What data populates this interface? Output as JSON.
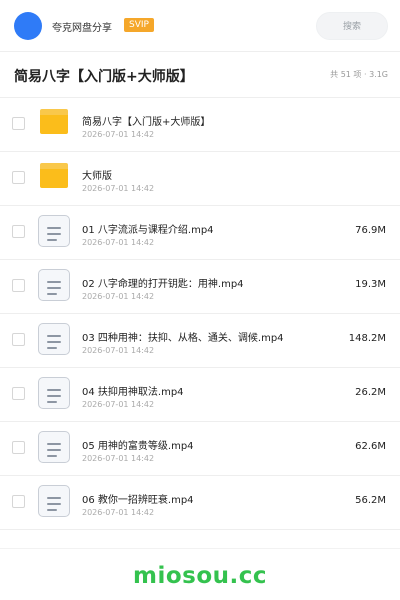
{
  "header": {
    "share_name": "夸克网盘分享",
    "badge": "SVIP",
    "search_placeholder": "搜索"
  },
  "titlebar": {
    "title": "简易八字【入门版+大师版】",
    "meta": "共 51 项 · 3.1G"
  },
  "items": [
    {
      "type": "folder",
      "name": "简易八字【入门版+大师版】",
      "date": "2026-07-01 14:42",
      "size": ""
    },
    {
      "type": "folder",
      "name": "大师版",
      "date": "2026-07-01 14:42",
      "size": ""
    },
    {
      "type": "file",
      "name": "01 八字流派与课程介绍.mp4",
      "date": "2026-07-01 14:42",
      "size": "76.9M"
    },
    {
      "type": "file",
      "name": "02 八字命理的打开钥匙：用神.mp4",
      "date": "2026-07-01 14:42",
      "size": "19.3M"
    },
    {
      "type": "file",
      "name": "03 四种用神：扶抑、从格、通关、调候.mp4",
      "date": "2026-07-01 14:42",
      "size": "148.2M"
    },
    {
      "type": "file",
      "name": "04 扶抑用神取法.mp4",
      "date": "2026-07-01 14:42",
      "size": "26.2M"
    },
    {
      "type": "file",
      "name": "05 用神的富贵等级.mp4",
      "date": "2026-07-01 14:42",
      "size": "62.6M"
    },
    {
      "type": "file",
      "name": "06 教你一招辨旺衰.mp4",
      "date": "2026-07-01 14:42",
      "size": "56.2M"
    }
  ],
  "footer": {
    "watermark": "miosou.cc"
  },
  "colors": {
    "avatar": "#2f7bf7",
    "svip": "#f5a72a",
    "folder": "#fbbd1b",
    "watermark": "#34c24e"
  }
}
